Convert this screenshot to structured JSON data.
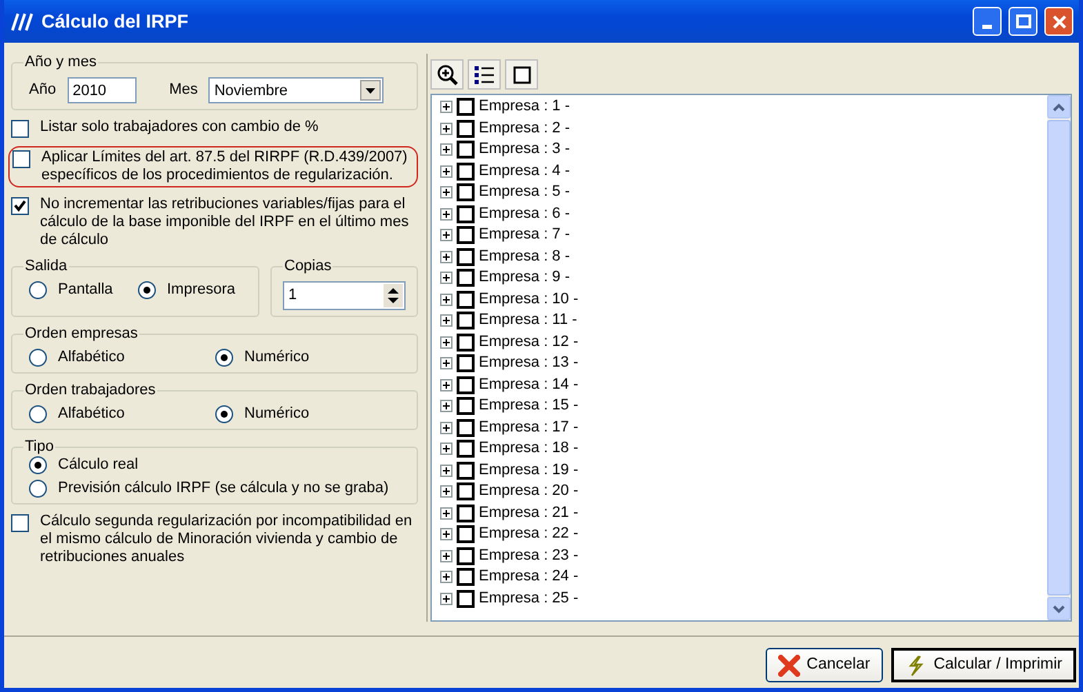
{
  "window": {
    "title": "Cálculo del IRPF"
  },
  "ano_y_mes": {
    "legend": "Año y mes",
    "ano_label": "Año",
    "ano_value": "2010",
    "mes_label": "Mes",
    "mes_value": "Noviembre"
  },
  "top_checkboxes": [
    {
      "label": "Listar solo trabajadores con cambio de %",
      "checked": false,
      "highlighted": false
    },
    {
      "label": "Aplicar Límites del art. 87.5 del RIRPF (R.D.439/2007) específicos de los procedimientos de regularización.",
      "checked": false,
      "highlighted": true
    },
    {
      "label": "No incrementar las retribuciones variables/fijas para el cálculo de la base imponible del IRPF en el último mes de cálculo",
      "checked": true,
      "highlighted": false
    }
  ],
  "salida": {
    "legend": "Salida",
    "options": [
      {
        "label": "Pantalla",
        "selected": false
      },
      {
        "label": "Impresora",
        "selected": true
      }
    ]
  },
  "copias": {
    "legend": "Copias",
    "value": "1"
  },
  "orden_empresas": {
    "legend": "Orden empresas",
    "options": [
      {
        "label": "Alfabético",
        "selected": false
      },
      {
        "label": "Numérico",
        "selected": true
      }
    ]
  },
  "orden_trabajadores": {
    "legend": "Orden trabajadores",
    "options": [
      {
        "label": "Alfabético",
        "selected": false
      },
      {
        "label": "Numérico",
        "selected": true
      }
    ]
  },
  "tipo": {
    "legend": "Tipo",
    "options": [
      {
        "label": "Cálculo real",
        "selected": true
      },
      {
        "label": "Previsión cálculo IRPF (se cálcula y no se graba)",
        "selected": false
      }
    ]
  },
  "bottom_checkbox": {
    "label": "Cálculo segunda regularización por incompatibilidad en el mismo cálculo de Minoración vivienda y cambio de retribuciones anuales",
    "checked": false
  },
  "tree": {
    "items": [
      {
        "label": "Empresa : 1 -",
        "checked": false,
        "expanded": false
      },
      {
        "label": "Empresa : 2 -",
        "checked": false,
        "expanded": false
      },
      {
        "label": "Empresa : 3 -",
        "checked": false,
        "expanded": false
      },
      {
        "label": "Empresa : 4 -",
        "checked": false,
        "expanded": false
      },
      {
        "label": "Empresa : 5 -",
        "checked": false,
        "expanded": false
      },
      {
        "label": "Empresa : 6 -",
        "checked": false,
        "expanded": false
      },
      {
        "label": "Empresa : 7 -",
        "checked": false,
        "expanded": false
      },
      {
        "label": "Empresa : 8 -",
        "checked": false,
        "expanded": false
      },
      {
        "label": "Empresa : 9 -",
        "checked": false,
        "expanded": false
      },
      {
        "label": "Empresa : 10 -",
        "checked": false,
        "expanded": false
      },
      {
        "label": "Empresa : 11 -",
        "checked": false,
        "expanded": false
      },
      {
        "label": "Empresa : 12 -",
        "checked": false,
        "expanded": false
      },
      {
        "label": "Empresa : 13 -",
        "checked": false,
        "expanded": false
      },
      {
        "label": "Empresa : 14 -",
        "checked": false,
        "expanded": false
      },
      {
        "label": "Empresa : 15 -",
        "checked": false,
        "expanded": false
      },
      {
        "label": "Empresa : 17 -",
        "checked": false,
        "expanded": false
      },
      {
        "label": "Empresa : 18 -",
        "checked": false,
        "expanded": false
      },
      {
        "label": "Empresa : 19 -",
        "checked": false,
        "expanded": false
      },
      {
        "label": "Empresa : 20 -",
        "checked": false,
        "expanded": false
      },
      {
        "label": "Empresa : 21 -",
        "checked": false,
        "expanded": false
      },
      {
        "label": "Empresa : 22 -",
        "checked": false,
        "expanded": false
      },
      {
        "label": "Empresa : 23 -",
        "checked": false,
        "expanded": false
      },
      {
        "label": "Empresa : 24 -",
        "checked": false,
        "expanded": false
      },
      {
        "label": "Empresa : 25 -",
        "checked": false,
        "expanded": false
      }
    ]
  },
  "buttons": [
    {
      "label": "Cancelar",
      "kind": "cancel"
    },
    {
      "label": "Calcular / Imprimir",
      "kind": "calculate"
    }
  ]
}
